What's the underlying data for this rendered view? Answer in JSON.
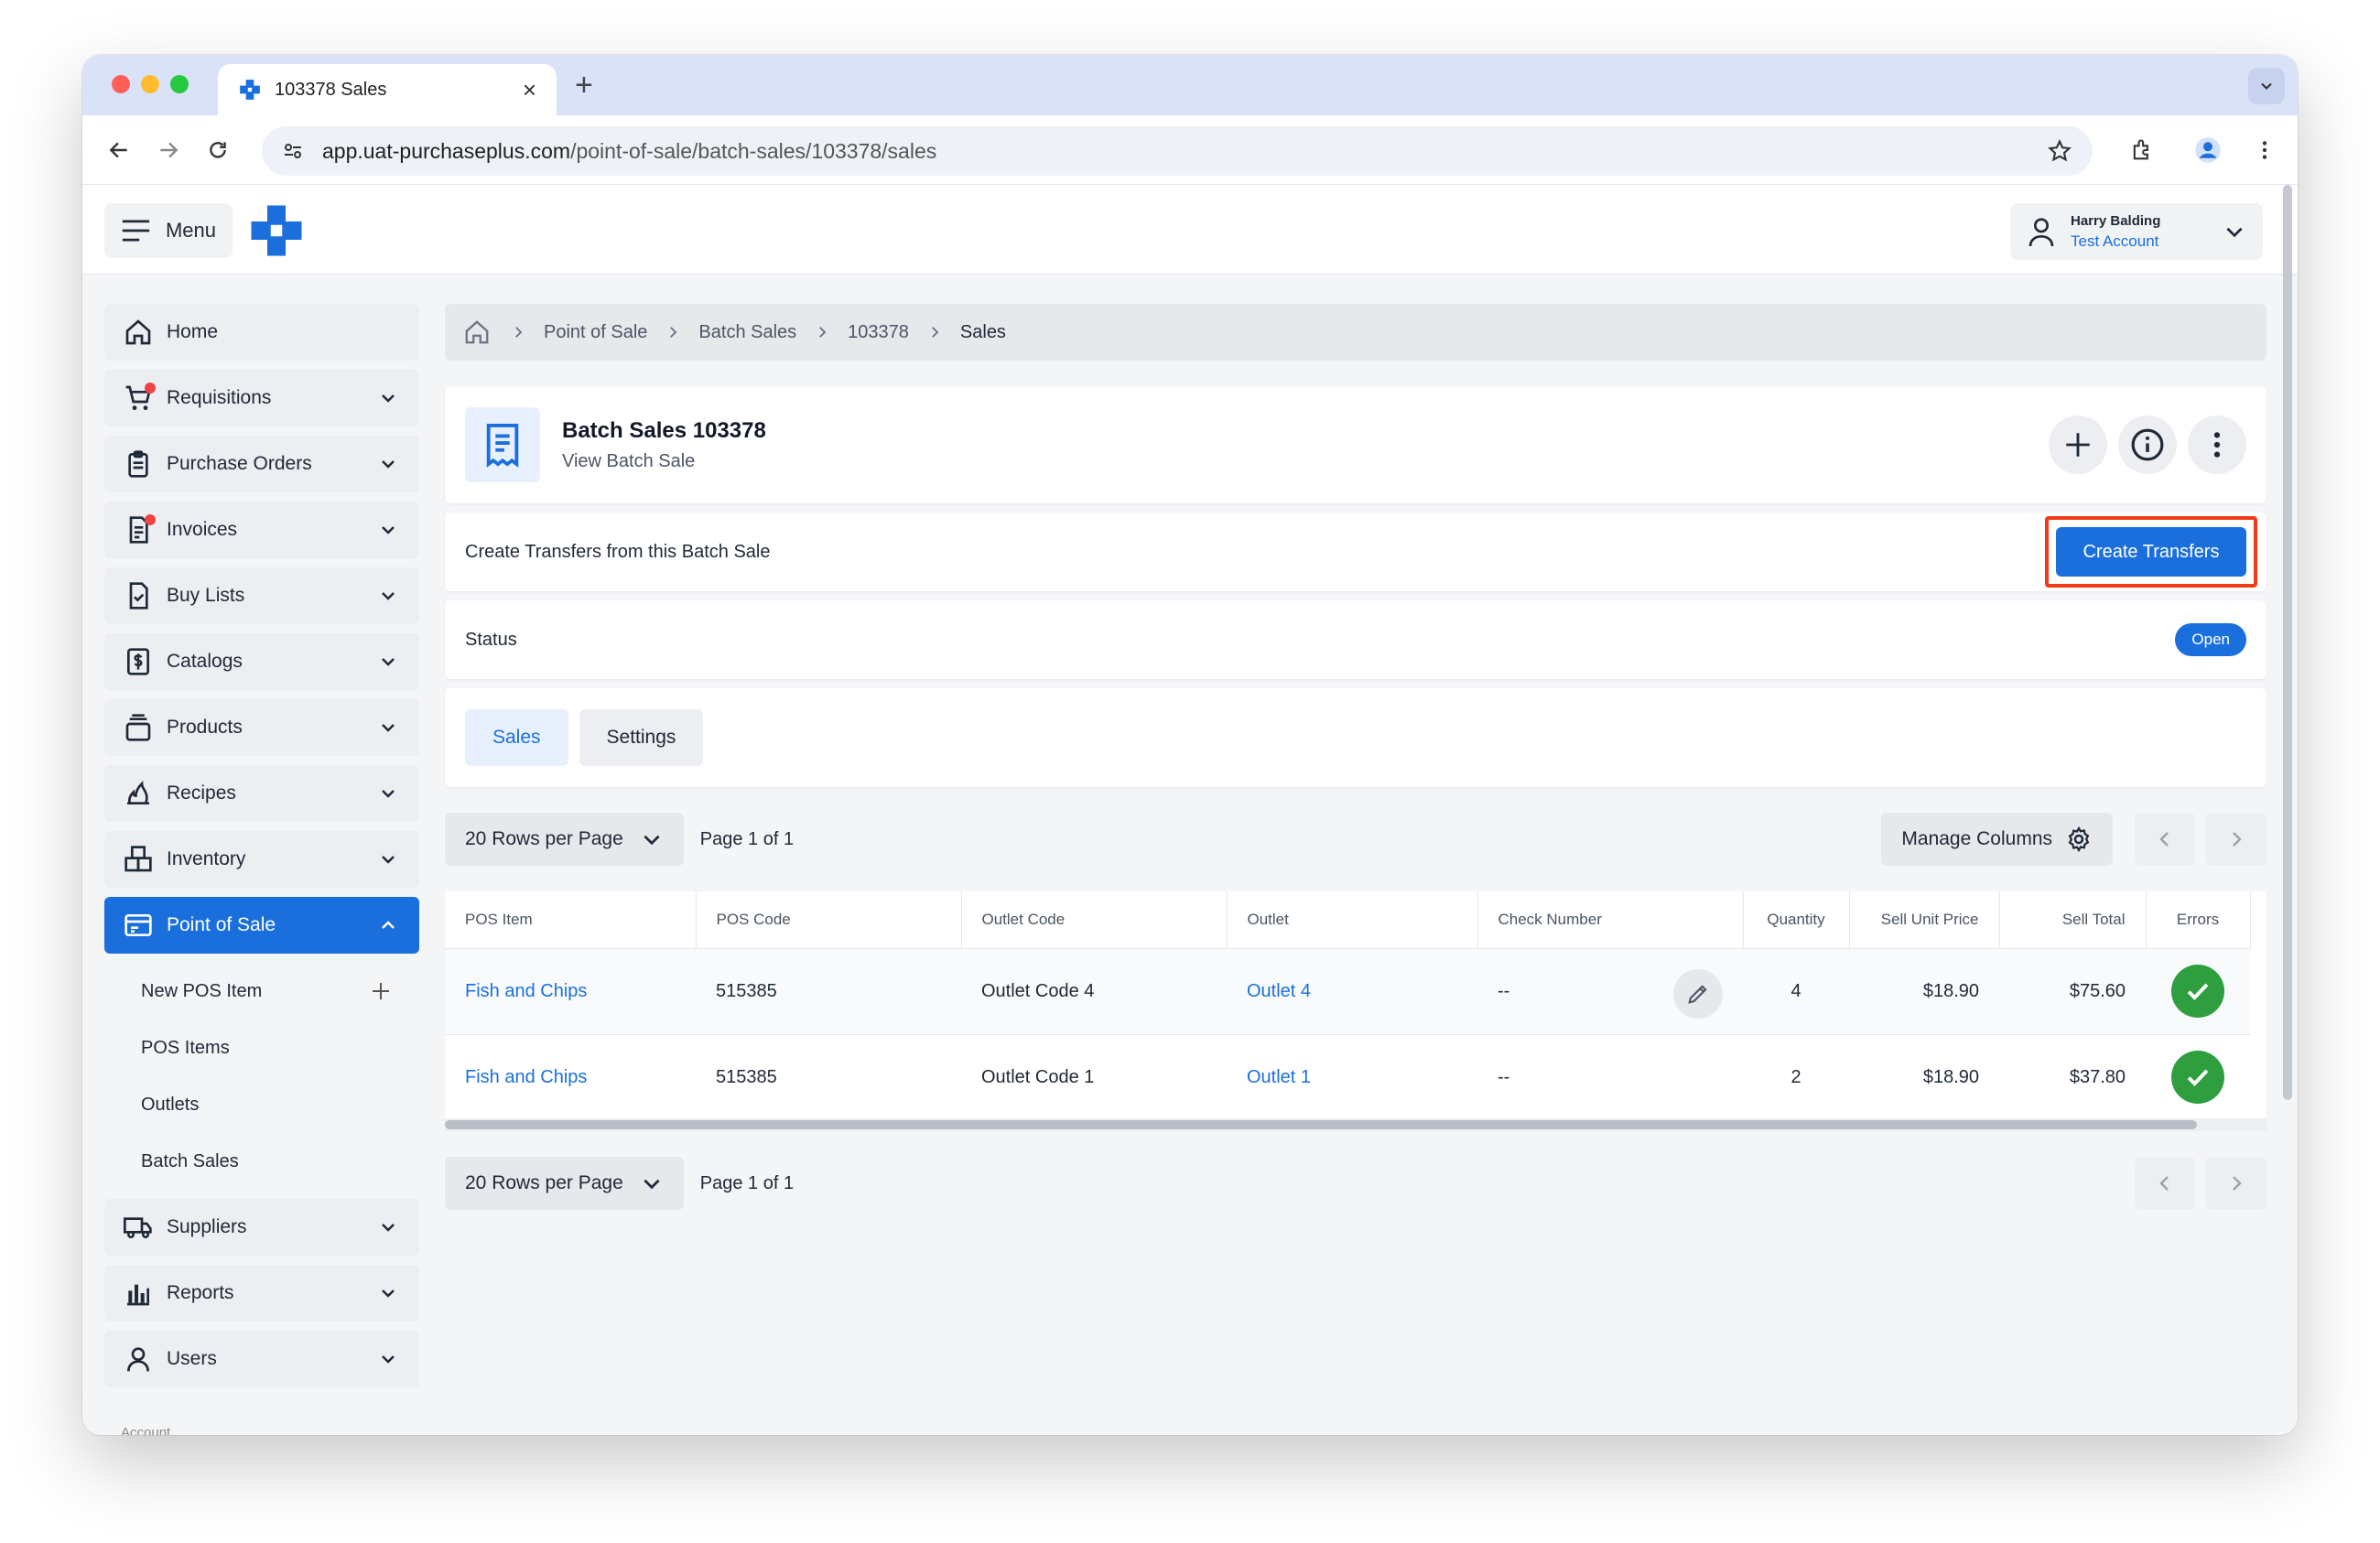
{
  "browser": {
    "tab_title": "103378 Sales",
    "url_host": "app.uat-purchaseplus.com",
    "url_path": "/point-of-sale/batch-sales/103378/sales"
  },
  "header": {
    "menu_label": "Menu",
    "user_name": "Harry Balding",
    "user_account": "Test Account"
  },
  "sidebar": {
    "items": [
      {
        "label": "Home",
        "icon": "home-icon"
      },
      {
        "label": "Requisitions",
        "icon": "cart-icon"
      },
      {
        "label": "Purchase Orders",
        "icon": "clipboard-icon"
      },
      {
        "label": "Invoices",
        "icon": "invoice-icon"
      },
      {
        "label": "Buy Lists",
        "icon": "checklist-icon"
      },
      {
        "label": "Catalogs",
        "icon": "dollar-doc-icon"
      },
      {
        "label": "Products",
        "icon": "box-icon"
      },
      {
        "label": "Recipes",
        "icon": "flame-icon"
      },
      {
        "label": "Inventory",
        "icon": "boxes-icon"
      },
      {
        "label": "Point of Sale",
        "icon": "card-icon"
      },
      {
        "label": "Suppliers",
        "icon": "truck-icon"
      },
      {
        "label": "Reports",
        "icon": "bar-chart-icon"
      },
      {
        "label": "Users",
        "icon": "user-icon"
      }
    ],
    "sub_items": [
      "New POS Item",
      "POS Items",
      "Outlets",
      "Batch Sales"
    ],
    "more_label": "Account"
  },
  "breadcrumb": [
    "Point of Sale",
    "Batch Sales",
    "103378",
    "Sales"
  ],
  "page": {
    "title": "Batch Sales 103378",
    "subtitle": "View Batch Sale",
    "transfer_text": "Create Transfers from this Batch Sale",
    "transfer_button": "Create Transfers",
    "status_label": "Status",
    "status_value": "Open",
    "tabs": [
      "Sales",
      "Settings"
    ]
  },
  "pager": {
    "rows_per_page": "20 Rows per Page",
    "page_info": "Page 1 of 1",
    "manage_columns": "Manage Columns"
  },
  "table": {
    "headers": [
      "POS Item",
      "POS Code",
      "Outlet Code",
      "Outlet",
      "Check Number",
      "Quantity",
      "Sell Unit Price",
      "Sell Total",
      "Errors"
    ],
    "rows": [
      {
        "pos_item": "Fish and Chips",
        "pos_code": "515385",
        "outlet_code": "Outlet Code 4",
        "outlet": "Outlet 4",
        "check_number": "--",
        "quantity": "4",
        "unit_price": "$18.90",
        "total": "$75.60"
      },
      {
        "pos_item": "Fish and Chips",
        "pos_code": "515385",
        "outlet_code": "Outlet Code 1",
        "outlet": "Outlet 1",
        "check_number": "--",
        "quantity": "2",
        "unit_price": "$18.90",
        "total": "$37.80"
      }
    ]
  },
  "colors": {
    "accent": "#1a6fdc",
    "highlight": "#ef3b17",
    "success": "#2e9e3e"
  }
}
